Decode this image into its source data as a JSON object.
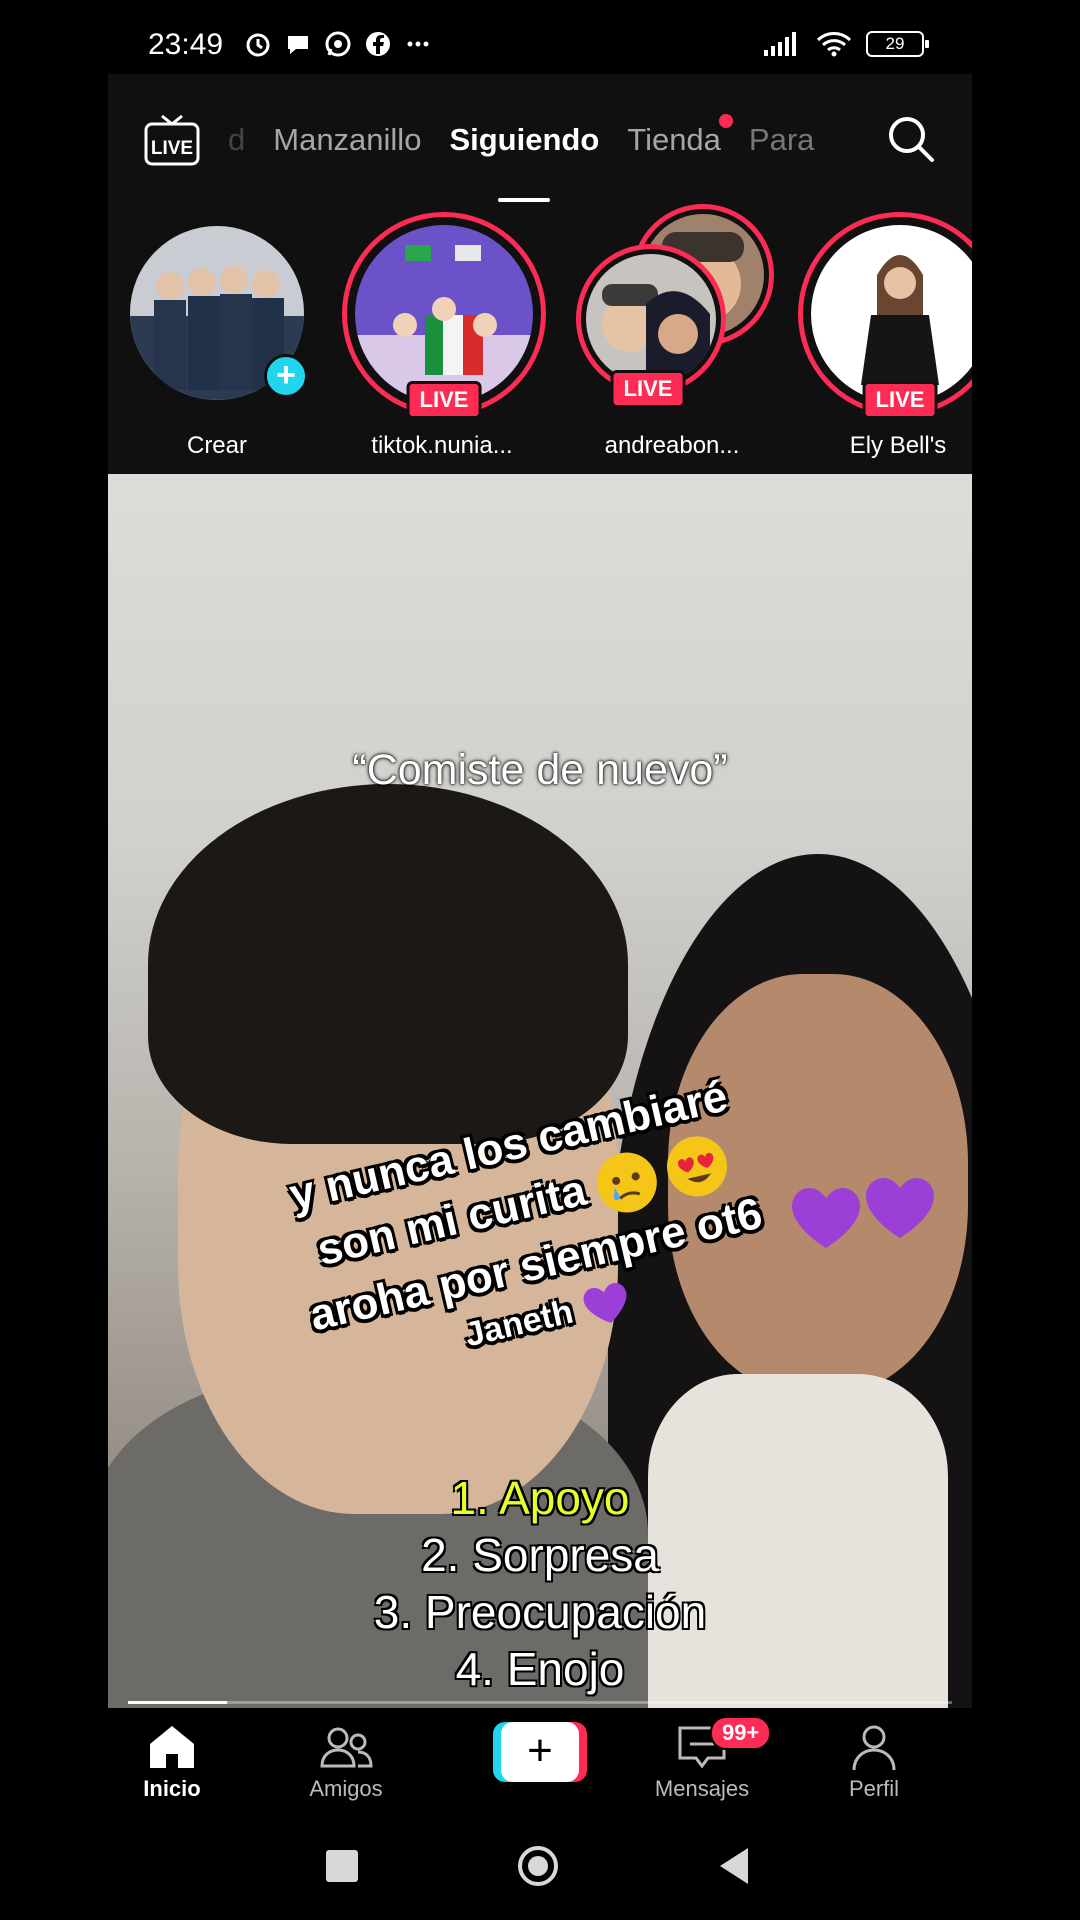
{
  "status_bar": {
    "time": "23:49",
    "battery": "29",
    "icons_left": [
      "alarm-icon",
      "chat-bubble-icon",
      "whatsapp-icon",
      "facebook-icon",
      "more-dots-icon"
    ],
    "icons_right": [
      "signal-icon",
      "wifi-icon",
      "battery-icon"
    ]
  },
  "top_nav": {
    "tabs": [
      {
        "label": "d",
        "state": "faded"
      },
      {
        "label": "Manzanillo",
        "state": "normal"
      },
      {
        "label": "Siguiendo",
        "state": "active"
      },
      {
        "label": "Tienda",
        "state": "normal",
        "dot": true
      },
      {
        "label": "Para",
        "state": "dim"
      }
    ],
    "live_label": "LIVE"
  },
  "stories": [
    {
      "name": "Crear",
      "badge": "+"
    },
    {
      "name": "tiktok.nunia...",
      "badge": "LIVE"
    },
    {
      "name": "andreabon...",
      "badge": "LIVE"
    },
    {
      "name": "Ely Bell's",
      "badge": "LIVE"
    }
  ],
  "video": {
    "caption_top": "“Comiste de nuevo”",
    "overlay_lines": [
      "y nunca los cambiaré",
      "son mi curita",
      "aroha por siempre ot6",
      "Janeth"
    ],
    "list": [
      "1. Apoyo",
      "2. Sorpresa",
      "3. Preocupación",
      "4. Enojo"
    ],
    "progress": 0.12
  },
  "bottom_nav": {
    "items": [
      {
        "label": "Inicio",
        "icon": "home-icon",
        "active": true
      },
      {
        "label": "Amigos",
        "icon": "friends-icon",
        "active": false
      },
      {
        "label": "",
        "icon": "create-plus-icon",
        "active": false
      },
      {
        "label": "Mensajes",
        "icon": "inbox-icon",
        "active": false,
        "badge": "99+"
      },
      {
        "label": "Perfil",
        "icon": "profile-icon",
        "active": false
      }
    ]
  },
  "colors": {
    "accent_pink": "#fe2c55",
    "accent_cyan": "#20d5ec",
    "highlight_yellow": "#e4ff2a"
  }
}
